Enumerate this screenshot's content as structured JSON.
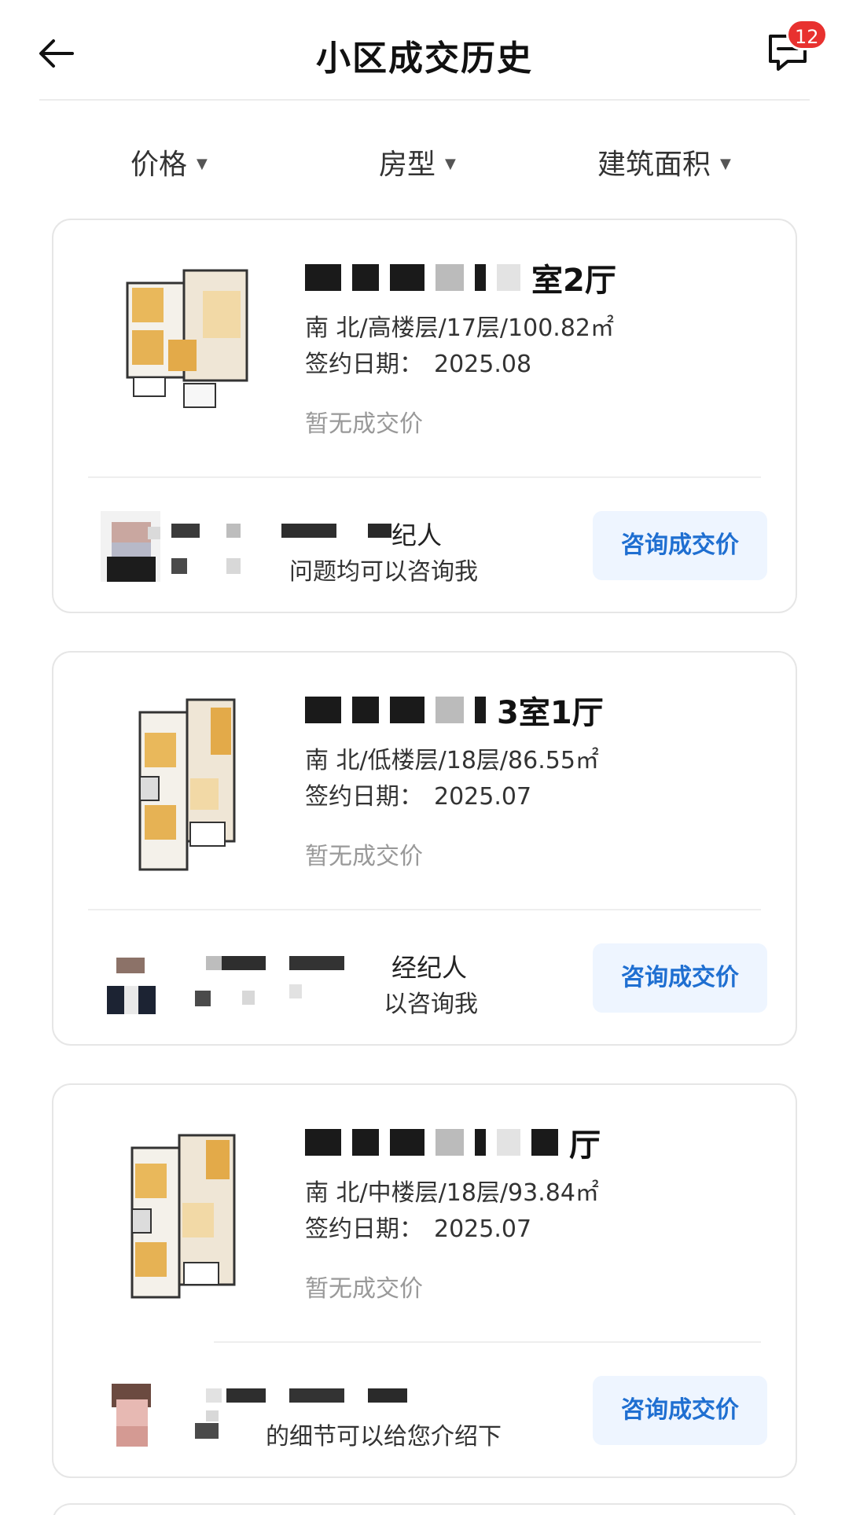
{
  "header": {
    "title": "小区成交历史",
    "badge_count": "12"
  },
  "filters": [
    {
      "label": "价格"
    },
    {
      "label": "房型"
    },
    {
      "label": "建筑面积"
    }
  ],
  "listings": [
    {
      "title_suffix": "室2厅",
      "meta": "南 北/高楼层/17层/100.82㎡",
      "sign_label": "签约日期：",
      "sign_value": "2025.08",
      "price": "暂无成交价",
      "agent_title": "纪人",
      "agent_sub": "问题均可以咨询我",
      "cta": "咨询成交价"
    },
    {
      "title_suffix": "3室1厅",
      "meta": "南 北/低楼层/18层/86.55㎡",
      "sign_label": "签约日期：",
      "sign_value": "2025.07",
      "price": "暂无成交价",
      "agent_title": "经纪人",
      "agent_sub": "以咨询我",
      "cta": "咨询成交价"
    },
    {
      "title_suffix": "厅",
      "meta": "南 北/中楼层/18层/93.84㎡",
      "sign_label": "签约日期：",
      "sign_value": "2025.07",
      "price": "暂无成交价",
      "agent_title": "",
      "agent_sub": "的细节可以给您介绍下",
      "cta": "咨询成交价"
    }
  ]
}
